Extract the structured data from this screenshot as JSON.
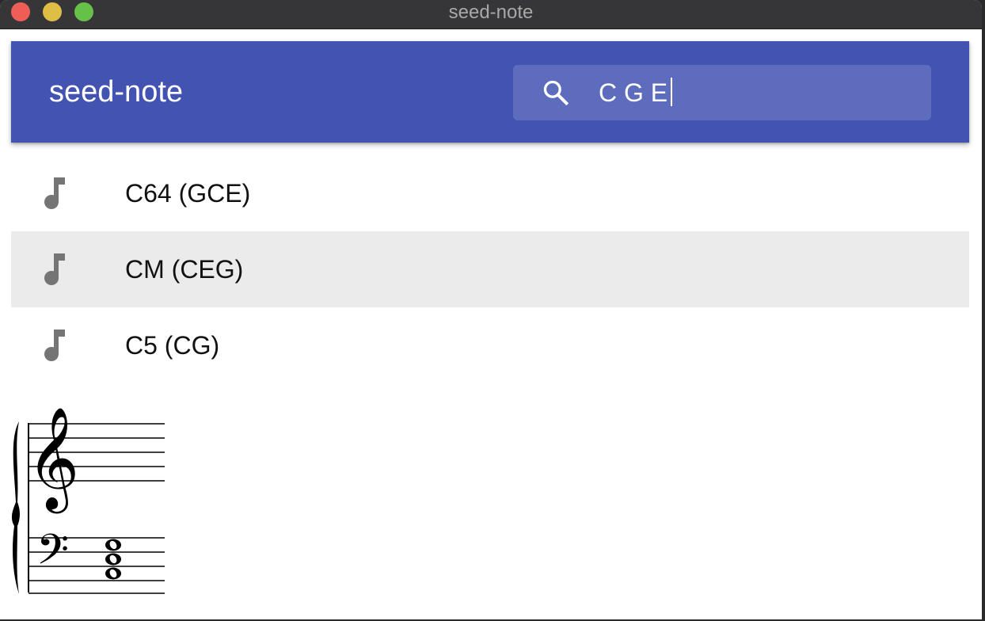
{
  "window": {
    "title": "seed-note"
  },
  "appbar": {
    "title": "seed-note",
    "search": {
      "value": "C G E",
      "icon": "search-icon"
    }
  },
  "results": [
    {
      "label": "C64 (GCE)",
      "icon": "music-note-icon",
      "selected": false
    },
    {
      "label": "CM (CEG)",
      "icon": "music-note-icon",
      "selected": true
    },
    {
      "label": "C5 (CG)",
      "icon": "music-note-icon",
      "selected": false
    }
  ],
  "score": {
    "staves": [
      "treble",
      "bass"
    ],
    "chord": [
      "C",
      "E",
      "G"
    ]
  },
  "colors": {
    "primary": "#4353b2",
    "search_bg": "#5d6cbd",
    "selected_row": "#ebebeb",
    "icon_gray": "#757575"
  }
}
